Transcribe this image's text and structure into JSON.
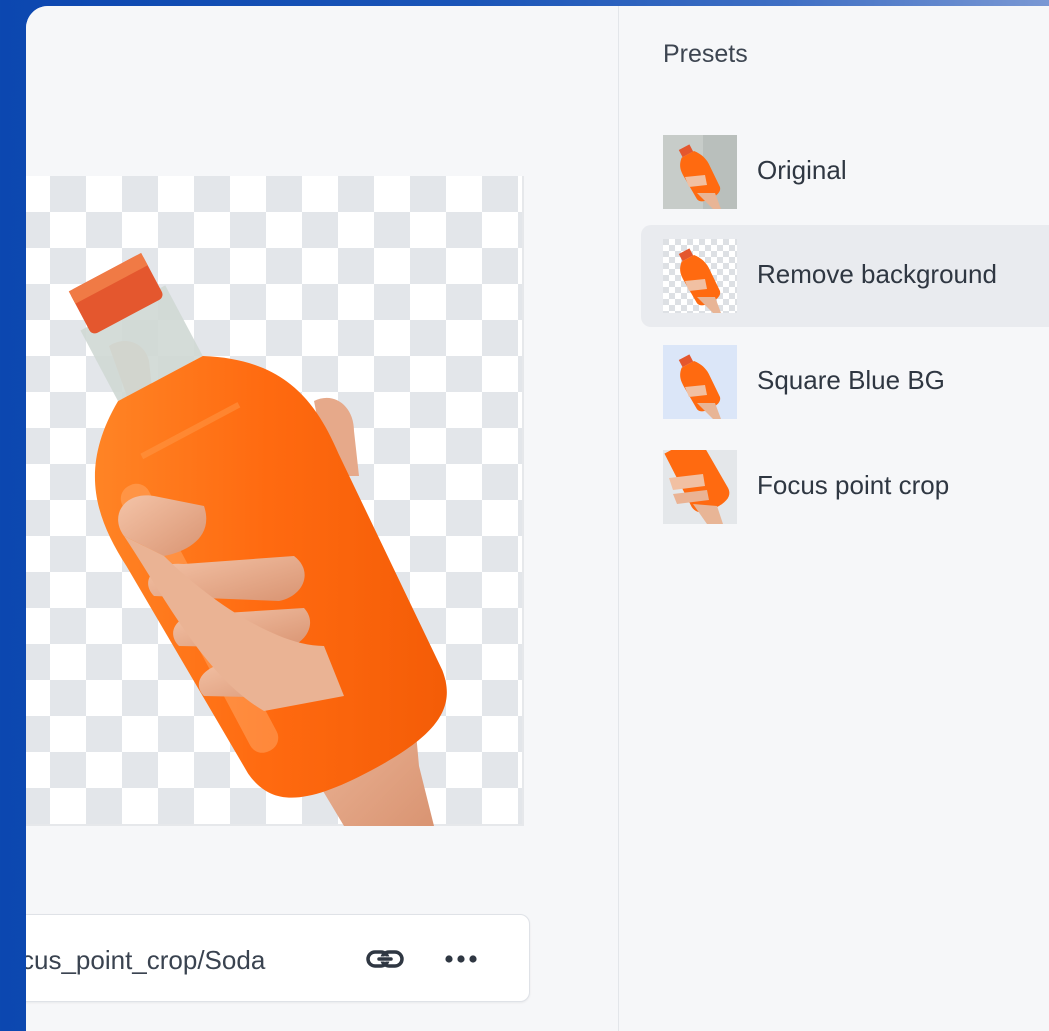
{
  "presets_panel": {
    "title": "Presets",
    "items": [
      {
        "label": "Original",
        "thumb": "original",
        "selected": false
      },
      {
        "label": "Remove background",
        "thumb": "transparent",
        "selected": true
      },
      {
        "label": "Square Blue BG",
        "thumb": "blue",
        "selected": false
      },
      {
        "label": "Focus point crop",
        "thumb": "crop",
        "selected": false
      }
    ]
  },
  "url_bar": {
    "text": "cus_point_crop/Soda",
    "link_icon": "link-icon",
    "more_icon": "more-horizontal-icon"
  },
  "colors": {
    "background_blue": "#0c47b0",
    "soda_orange": "#ff6a10",
    "thumb_blue_bg": "#dbe6f8"
  }
}
